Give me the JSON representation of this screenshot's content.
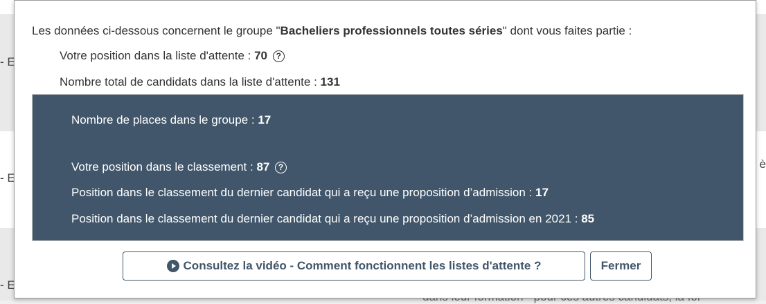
{
  "background": {
    "side_marker": "- E",
    "right_marker": "è",
    "bottom_text": "dans leur formation - pour ces autres candidats, la for"
  },
  "modal": {
    "intro_prefix": "Les données ci-dessous concernent le groupe \"",
    "group_name": "Bacheliers professionnels toutes séries",
    "intro_suffix": "\" dont vous faites partie :",
    "waitlist_position_label": "Votre position dans la liste d'attente : ",
    "waitlist_position_value": "70",
    "waitlist_total_label": "Nombre total de candidats dans la liste d'attente : ",
    "waitlist_total_value": "131",
    "places_label": "Nombre de places dans le groupe : ",
    "places_value": "17",
    "ranking_position_label": "Votre position dans le classement : ",
    "ranking_position_value": "87",
    "last_admitted_label": "Position dans le classement du dernier candidat qui a reçu une proposition d’admission : ",
    "last_admitted_value": "17",
    "last_admitted_2021_label": "Position dans le classement du dernier candidat qui a reçu une proposition d’admission en 2021 : ",
    "last_admitted_2021_value": "85",
    "help_glyph": "?",
    "video_button_label": "Consultez la vidéo - Comment fonctionnent les listes d'attente ?",
    "close_button_label": "Fermer"
  },
  "colors": {
    "panel": "#41566b",
    "text": "#333333",
    "button_border": "#41566b"
  }
}
